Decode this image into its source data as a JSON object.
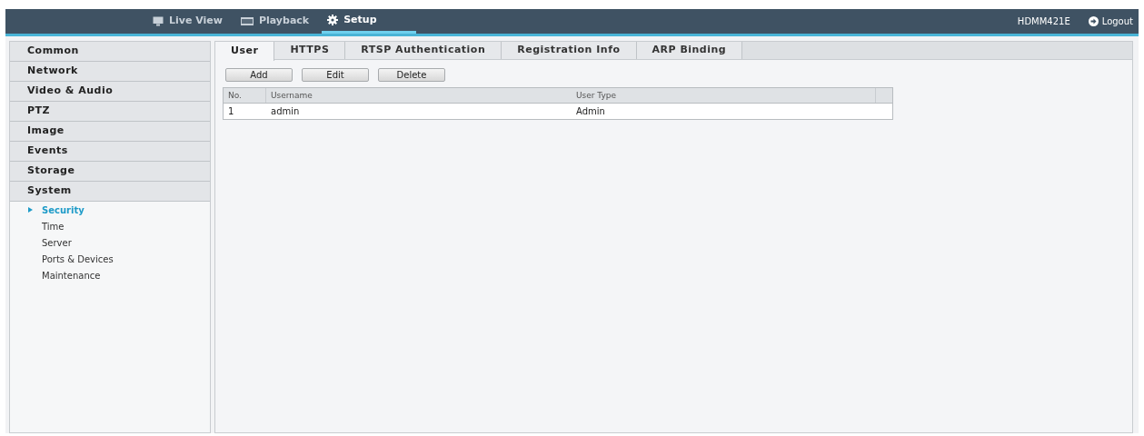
{
  "nav": {
    "tabs": [
      {
        "label": "Live View",
        "selected": false
      },
      {
        "label": "Playback",
        "selected": false
      },
      {
        "label": "Setup",
        "selected": true
      }
    ],
    "device": "HDMM421E",
    "logout": "Logout"
  },
  "sidebar": {
    "items": [
      {
        "label": "Common"
      },
      {
        "label": "Network"
      },
      {
        "label": "Video & Audio"
      },
      {
        "label": "PTZ"
      },
      {
        "label": "Image"
      },
      {
        "label": "Events"
      },
      {
        "label": "Storage"
      },
      {
        "label": "System",
        "children": [
          {
            "label": "Security",
            "selected": true
          },
          {
            "label": "Time",
            "selected": false
          },
          {
            "label": "Server",
            "selected": false
          },
          {
            "label": "Ports & Devices",
            "selected": false
          },
          {
            "label": "Maintenance",
            "selected": false
          }
        ]
      }
    ]
  },
  "tabs": [
    {
      "label": "User",
      "selected": true
    },
    {
      "label": "HTTPS",
      "selected": false
    },
    {
      "label": "RTSP Authentication",
      "selected": false
    },
    {
      "label": "Registration Info",
      "selected": false
    },
    {
      "label": "ARP Binding",
      "selected": false
    }
  ],
  "buttons": [
    "Add",
    "Edit",
    "Delete"
  ],
  "table": {
    "columns": [
      "No.",
      "Username",
      "User Type"
    ],
    "rows": [
      [
        "1",
        "admin",
        "Admin"
      ]
    ]
  }
}
